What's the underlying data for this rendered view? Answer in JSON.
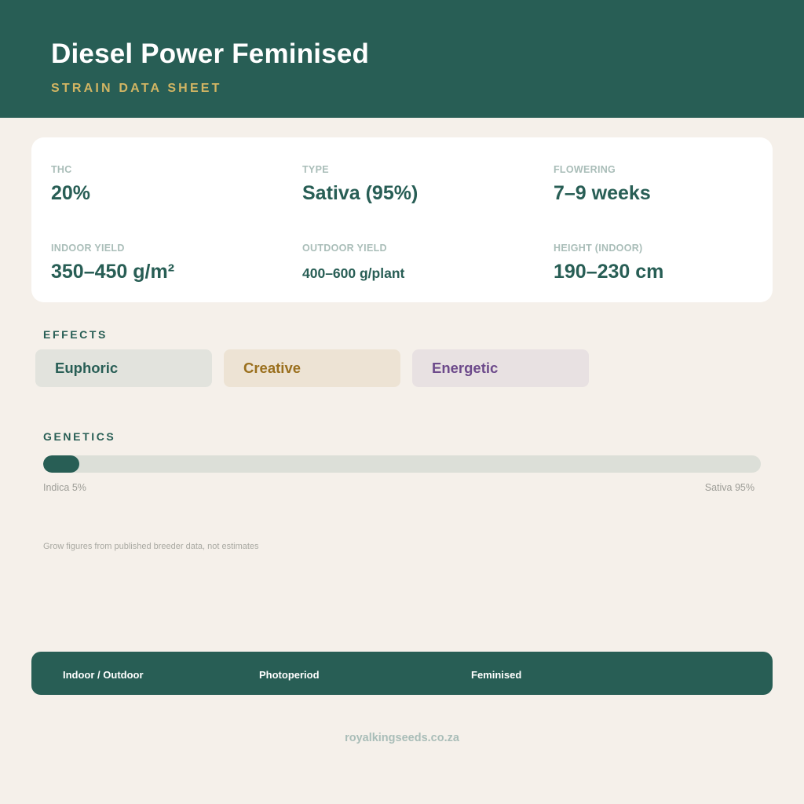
{
  "header": {
    "title": "Diesel Power Feminised",
    "subtitle": "STRAIN DATA SHEET"
  },
  "stats": [
    {
      "label": "THC",
      "value": "20%"
    },
    {
      "label": "TYPE",
      "value": "Sativa (95%)"
    },
    {
      "label": "FLOWERING",
      "value": "7–9 weeks"
    },
    {
      "label": "INDOOR YIELD",
      "value": "350–450 g/m²"
    },
    {
      "label": "OUTDOOR YIELD",
      "value": "400–600 g/plant"
    },
    {
      "label": "HEIGHT (INDOOR)",
      "value": "190–230 cm"
    }
  ],
  "effects": {
    "label": "EFFECTS",
    "items": [
      {
        "name": "Euphoric",
        "text_color": "#285e55",
        "bg_color": "#e2e3dd"
      },
      {
        "name": "Creative",
        "text_color": "#9a6f1d",
        "bg_color": "#ede3d4"
      },
      {
        "name": "Energetic",
        "text_color": "#6d4a8b",
        "bg_color": "#e8e1e2"
      }
    ]
  },
  "genetics": {
    "label": "GENETICS",
    "indica_percent": 5,
    "sativa_percent": 95,
    "indica_caption": "Indica 5%",
    "sativa_caption": "Sativa 95%"
  },
  "footnote": "Grow figures from published breeder data, not estimates",
  "tags": [
    "Indoor / Outdoor",
    "Photoperiod",
    "Feminised"
  ],
  "site": "royalkingseeds.co.za",
  "colors": {
    "primary": "#285e55",
    "accent": "#d2b563",
    "background": "#f5f0ea"
  }
}
